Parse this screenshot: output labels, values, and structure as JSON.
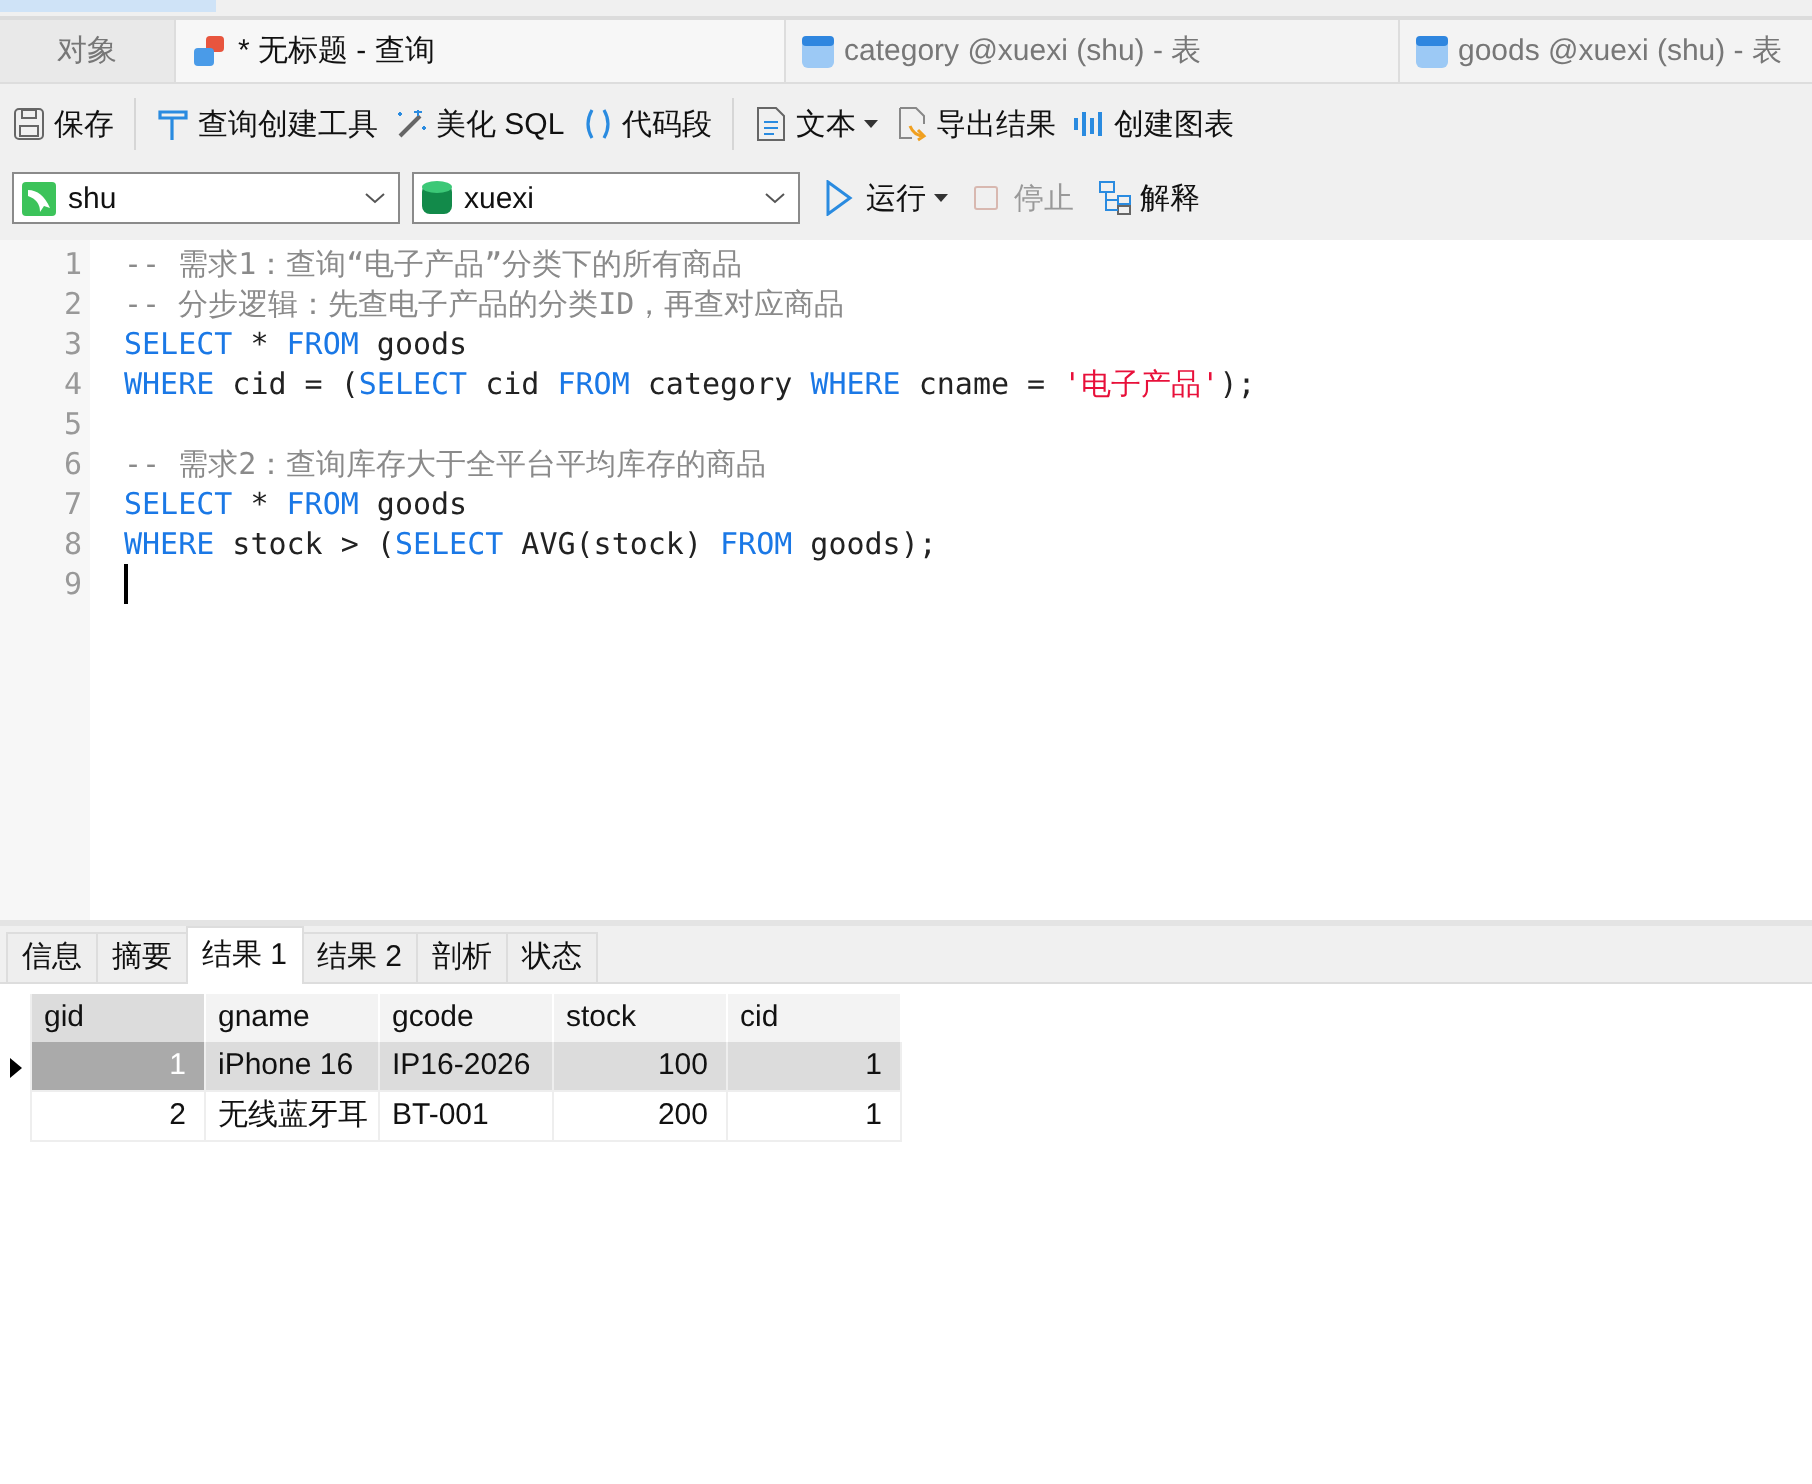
{
  "tabs": [
    {
      "label": "对象",
      "kind": "plain",
      "selected": false
    },
    {
      "label": "* 无标题 - 查询",
      "kind": "query",
      "selected": true
    },
    {
      "label": "category @xuexi (shu) - 表",
      "kind": "table",
      "selected": false
    },
    {
      "label": "goods @xuexi (shu) - 表",
      "kind": "table",
      "selected": false
    }
  ],
  "toolbar": [
    [
      {
        "label": "保存",
        "dropdown": false
      }
    ],
    [
      {
        "label": "查询创建工具",
        "dropdown": false
      },
      {
        "label": "美化 SQL",
        "dropdown": false
      },
      {
        "label": "代码段",
        "dropdown": false
      }
    ],
    [
      {
        "label": "文本",
        "dropdown": true
      },
      {
        "label": "导出结果",
        "dropdown": false
      },
      {
        "label": "创建图表",
        "dropdown": false
      }
    ]
  ],
  "connection": {
    "value": "shu"
  },
  "database": {
    "value": "xuexi"
  },
  "run_bar": [
    {
      "label": "运行",
      "dropdown": true,
      "disabled": false
    },
    {
      "label": "停止",
      "dropdown": false,
      "disabled": true
    },
    {
      "label": "解释",
      "dropdown": false,
      "disabled": false
    }
  ],
  "editor": {
    "lines": [
      {
        "number": "1",
        "tokens": [
          {
            "kind": "comment",
            "text": "-- 需求1：查询“电子产品”分类下的所有商品"
          }
        ]
      },
      {
        "number": "2",
        "tokens": [
          {
            "kind": "comment",
            "text": "-- 分步逻辑：先查电子产品的分类ID，再查对应商品"
          }
        ]
      },
      {
        "number": "3",
        "tokens": [
          {
            "kind": "keyword",
            "text": "SELECT"
          },
          {
            "kind": "plain",
            "text": " * "
          },
          {
            "kind": "keyword",
            "text": "FROM"
          },
          {
            "kind": "plain",
            "text": " goods"
          }
        ]
      },
      {
        "number": "4",
        "tokens": [
          {
            "kind": "keyword",
            "text": "WHERE"
          },
          {
            "kind": "plain",
            "text": " cid = ("
          },
          {
            "kind": "keyword",
            "text": "SELECT"
          },
          {
            "kind": "plain",
            "text": " cid "
          },
          {
            "kind": "keyword",
            "text": "FROM"
          },
          {
            "kind": "plain",
            "text": " category "
          },
          {
            "kind": "keyword",
            "text": "WHERE"
          },
          {
            "kind": "plain",
            "text": " cname = "
          },
          {
            "kind": "string",
            "text": "'电子产品'"
          },
          {
            "kind": "plain",
            "text": ");"
          }
        ]
      },
      {
        "number": "5"
      },
      {
        "number": "6",
        "tokens": [
          {
            "kind": "comment",
            "text": "-- 需求2：查询库存大于全平台平均库存的商品"
          }
        ]
      },
      {
        "number": "7",
        "tokens": [
          {
            "kind": "keyword",
            "text": "SELECT"
          },
          {
            "kind": "plain",
            "text": " * "
          },
          {
            "kind": "keyword",
            "text": "FROM"
          },
          {
            "kind": "plain",
            "text": " goods"
          }
        ]
      },
      {
        "number": "8",
        "tokens": [
          {
            "kind": "keyword",
            "text": "WHERE"
          },
          {
            "kind": "plain",
            "text": " stock > ("
          },
          {
            "kind": "keyword",
            "text": "SELECT"
          },
          {
            "kind": "plain",
            "text": " AVG(stock) "
          },
          {
            "kind": "keyword",
            "text": "FROM"
          },
          {
            "kind": "plain",
            "text": " goods);"
          }
        ]
      },
      {
        "number": "9",
        "cursor": true
      }
    ]
  },
  "result_tabs": [
    {
      "label": "信息",
      "selected": false
    },
    {
      "label": "摘要",
      "selected": false
    },
    {
      "label": "结果 1",
      "selected": true
    },
    {
      "label": "结果 2",
      "selected": false
    },
    {
      "label": "剖析",
      "selected": false
    },
    {
      "label": "状态",
      "selected": false
    }
  ],
  "table": {
    "columns": [
      {
        "label": "gid",
        "kind": "number"
      },
      {
        "label": "gname",
        "kind": "text"
      },
      {
        "label": "gcode",
        "kind": "text"
      },
      {
        "label": "stock",
        "kind": "number"
      },
      {
        "label": "cid",
        "kind": "number"
      }
    ],
    "rows": [
      {
        "selected": true,
        "cells": [
          "1",
          "iPhone 16",
          "IP16-2026",
          "100",
          "1"
        ]
      },
      {
        "selected": false,
        "cells": [
          "2",
          "无线蓝牙耳",
          "BT-001",
          "200",
          "1"
        ]
      }
    ]
  }
}
